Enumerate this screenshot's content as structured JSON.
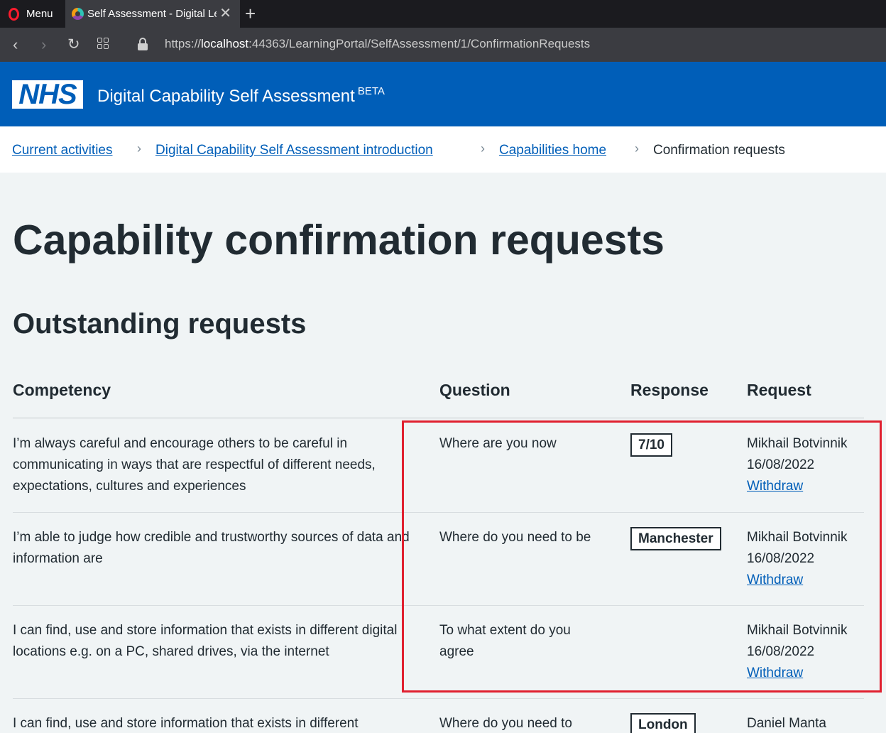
{
  "browser": {
    "menu_label": "Menu",
    "tab_title": "Self Assessment - Digital Le",
    "url_prefix": "https://",
    "url_host": "localhost",
    "url_rest": ":44363/LearningPortal/SelfAssessment/1/ConfirmationRequests"
  },
  "header": {
    "logo_text": "NHS",
    "service_name": "Digital Capability Self Assessment",
    "beta_label": "BETA",
    "brand_color": "#005eb8"
  },
  "breadcrumb": {
    "items": [
      "Current activities",
      "Digital Capability Self Assessment introduction",
      "Capabilities home"
    ],
    "current": "Confirmation requests"
  },
  "main": {
    "page_title": "Capability confirmation requests",
    "section_title": "Outstanding requests",
    "table": {
      "headers": [
        "Competency",
        "Question",
        "Response",
        "Request"
      ],
      "rows": [
        {
          "competency": "I’m always careful and encourage others to be careful in communicating in ways that are respectful of different needs, expectations, cultures and experiences",
          "question": "Where are you now",
          "response": "7/10",
          "requester": "Mikhail Botvinnik",
          "date": "16/08/2022",
          "action": "Withdraw"
        },
        {
          "competency": "I’m able to judge how credible and trustworthy sources of data and information are",
          "question": "Where do you need to be",
          "response": "Manchester",
          "requester": "Mikhail Botvinnik",
          "date": "16/08/2022",
          "action": "Withdraw"
        },
        {
          "competency": "I can find, use and store information that exists in different digital locations e.g. on a PC, shared drives, via the internet",
          "question": "To what extent do you agree",
          "response": "",
          "requester": "Mikhail Botvinnik",
          "date": "16/08/2022",
          "action": "Withdraw"
        },
        {
          "competency": "I can find, use and store information that exists in different",
          "question": "Where do you need to",
          "response": "London",
          "requester": "Daniel Manta"
        }
      ]
    }
  },
  "highlight_color": "#e0202f"
}
